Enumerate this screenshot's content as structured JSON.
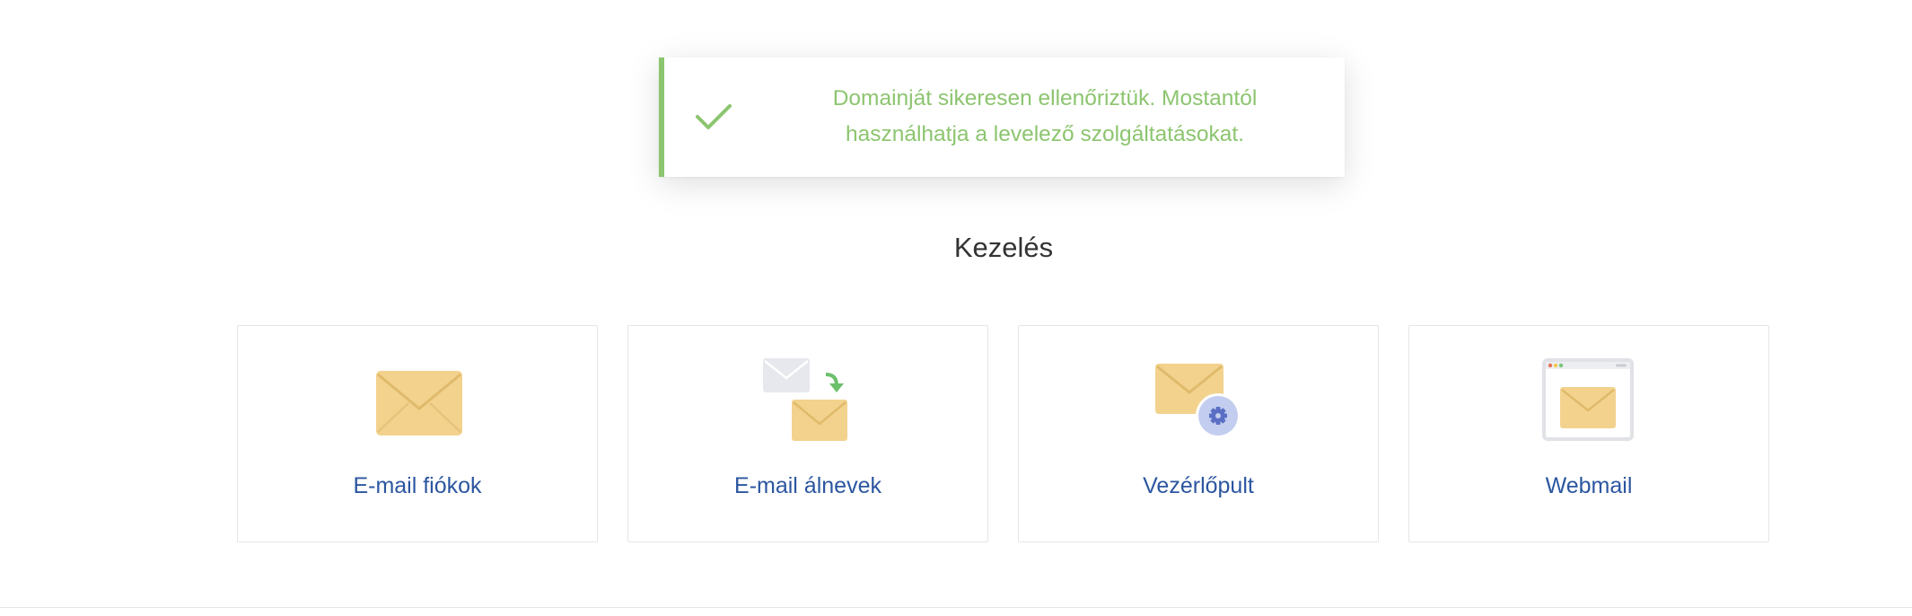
{
  "notification": {
    "type": "success",
    "icon": "checkmark-icon",
    "line1": "Domainját sikeresen ellenőriztük. Mostantól",
    "line2": "használhatja a levelező szolgáltatásokat.",
    "color": "#8cc56f"
  },
  "management": {
    "title": "Kezelés",
    "cards": [
      {
        "label": "E-mail fiókok",
        "icon": "envelope-icon"
      },
      {
        "label": "E-mail álnevek",
        "icon": "email-forward-icon"
      },
      {
        "label": "Vezérlőpult",
        "icon": "envelope-settings-icon"
      },
      {
        "label": "Webmail",
        "icon": "webmail-browser-icon"
      }
    ]
  },
  "colors": {
    "link": "#2b56a0",
    "envelope": "#f2d28d",
    "success": "#8cc56f",
    "gear_badge": "#c3cdef"
  }
}
